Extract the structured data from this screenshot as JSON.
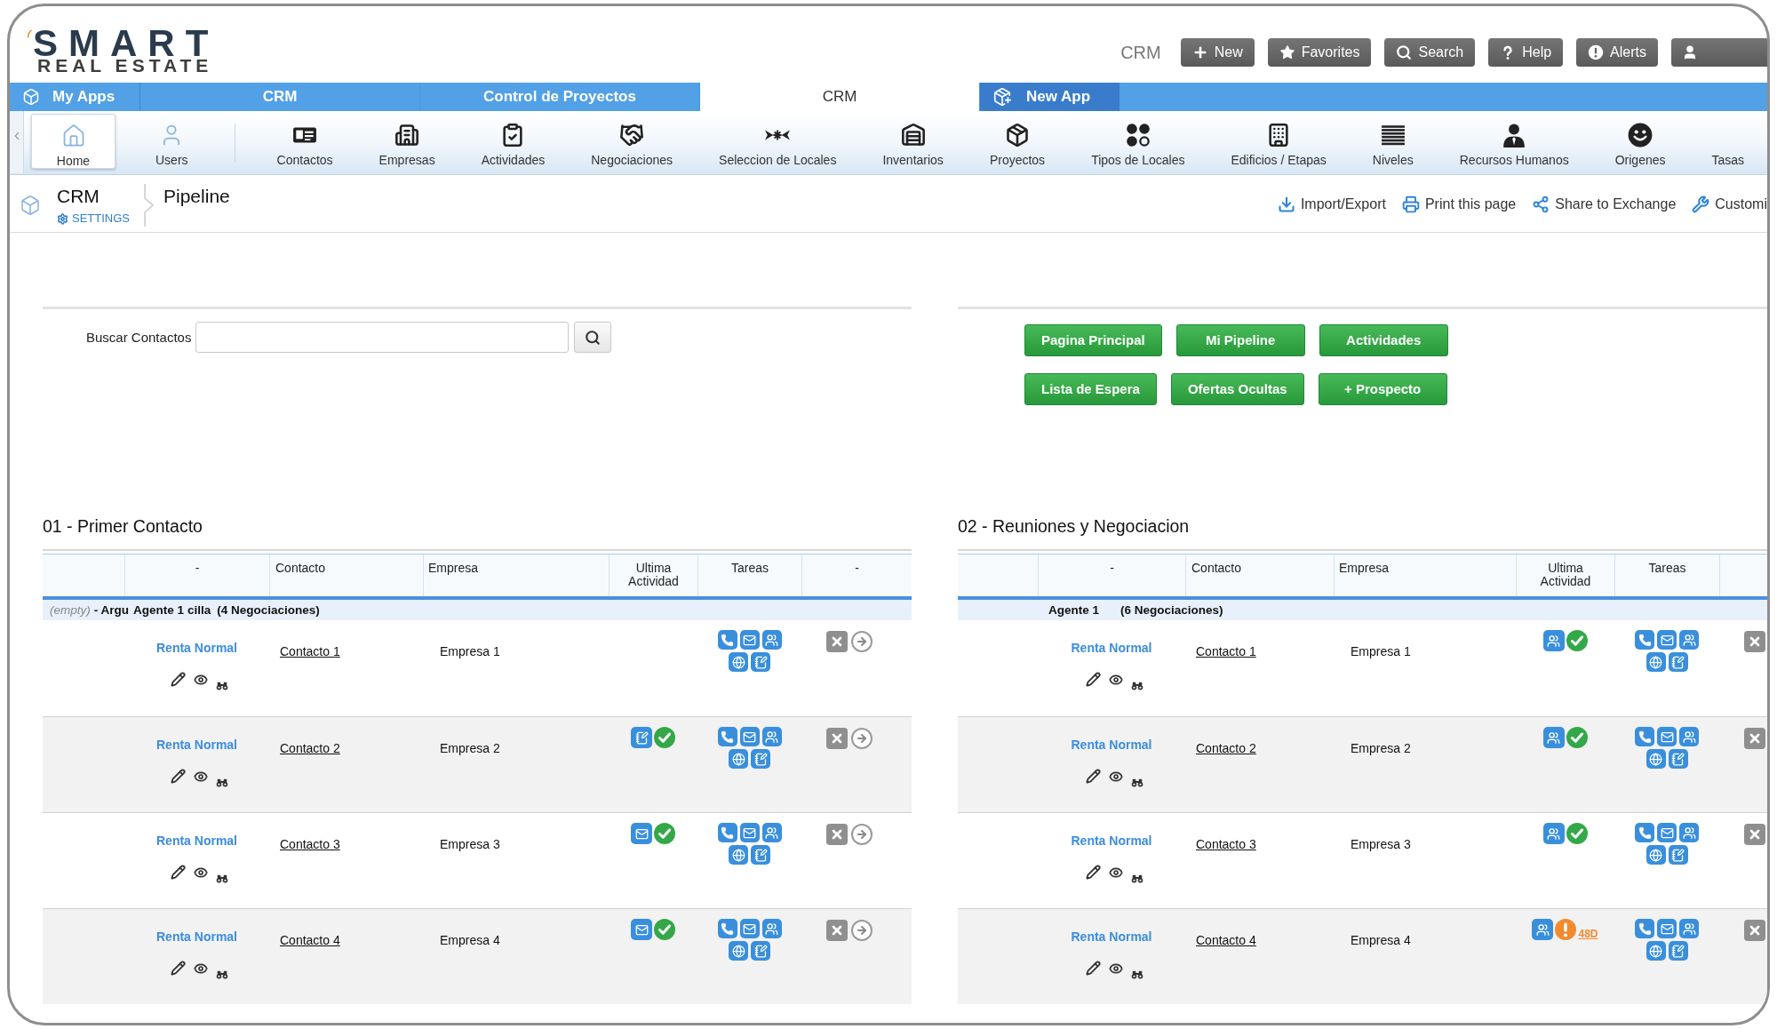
{
  "logo": {
    "wordmark": "SMART",
    "tagline": "REAL ESTATE"
  },
  "header": {
    "app_name": "CRM",
    "buttons": [
      {
        "label": "New"
      },
      {
        "label": "Favorites"
      },
      {
        "label": "Search"
      },
      {
        "label": "Help"
      },
      {
        "label": "Alerts"
      }
    ]
  },
  "app_tabs": [
    {
      "label": "My Apps",
      "kind": "apps",
      "selected": false
    },
    {
      "label": "CRM",
      "kind": "app",
      "selected": false
    },
    {
      "label": "Control de Proyectos",
      "kind": "app",
      "selected": false
    },
    {
      "label": "CRM",
      "kind": "app",
      "selected": true
    },
    {
      "label": "New App",
      "kind": "new",
      "selected": false
    }
  ],
  "nav_items": [
    {
      "label": "Home",
      "selected": true
    },
    {
      "label": "Users",
      "selected": false
    },
    {
      "label": "Contactos",
      "selected": false
    },
    {
      "label": "Empresas",
      "selected": false
    },
    {
      "label": "Actividades",
      "selected": false
    },
    {
      "label": "Negociaciones",
      "selected": false
    },
    {
      "label": "Seleccion de Locales",
      "selected": false
    },
    {
      "label": "Inventarios",
      "selected": false
    },
    {
      "label": "Proyectos",
      "selected": false
    },
    {
      "label": "Tipos de Locales",
      "selected": false
    },
    {
      "label": "Edificios / Etapas",
      "selected": false
    },
    {
      "label": "Niveles",
      "selected": false
    },
    {
      "label": "Recursos Humanos",
      "selected": false
    },
    {
      "label": "Origenes",
      "selected": false
    },
    {
      "label": "Tasas",
      "selected": false
    }
  ],
  "breadcrumb": {
    "app": "CRM",
    "settings": "SETTINGS",
    "page": "Pipeline"
  },
  "page_actions": [
    {
      "label": "Import/Export"
    },
    {
      "label": "Print this page"
    },
    {
      "label": "Share to Exchange"
    },
    {
      "label": "Customi"
    }
  ],
  "search": {
    "label": "Buscar Contactos"
  },
  "quick_links": [
    {
      "label": "Pagina Principal"
    },
    {
      "label": "Mi Pipeline"
    },
    {
      "label": "Actividades"
    },
    {
      "label": "Lista de Espera"
    },
    {
      "label": "Ofertas Ocultas"
    },
    {
      "label": "+ Prospecto"
    }
  ],
  "stages": [
    {
      "title": "01 - Primer Contacto",
      "columns": [
        "-",
        "Contacto",
        "Empresa",
        "Ultima Actividad",
        "Tareas",
        "-"
      ],
      "group": {
        "prefix": "(empty)",
        "owner": "- Argu",
        "agent": "Agente 1",
        "owner_rest": "cilla",
        "count": "(4 Negociaciones)"
      },
      "rows": [
        {
          "deal": "Renta Normal",
          "contact": "Contacto 1",
          "company": "Empresa 1",
          "actions": [
            {
              "kind": "remove"
            },
            {
              "kind": "forward"
            }
          ]
        },
        {
          "deal": "Renta Normal",
          "contact": "Contacto 2",
          "company": "Empresa 2",
          "activity": {
            "kind": "note",
            "overdue": false
          },
          "actions": [
            {
              "kind": "remove"
            },
            {
              "kind": "forward"
            }
          ]
        },
        {
          "deal": "Renta Normal",
          "contact": "Contacto 3",
          "company": "Empresa 3",
          "activity": {
            "kind": "email",
            "overdue": false
          },
          "actions": [
            {
              "kind": "remove"
            },
            {
              "kind": "forward"
            }
          ]
        },
        {
          "deal": "Renta Normal",
          "contact": "Contacto 4",
          "company": "Empresa 4",
          "activity": {
            "kind": "email",
            "overdue": false
          },
          "actions": [
            {
              "kind": "remove"
            },
            {
              "kind": "forward"
            }
          ]
        }
      ]
    },
    {
      "title": "02 - Reuniones y Negociacion",
      "columns": [
        "-",
        "Contacto",
        "Empresa",
        "Ultima Actividad",
        "Tareas"
      ],
      "group": {
        "agent": "Agente 1",
        "count": "(6 Negociaciones)"
      },
      "rows": [
        {
          "deal": "Renta Normal",
          "contact": "Contacto 1",
          "company": "Empresa 1",
          "activity": {
            "kind": "meeting",
            "overdue": false
          },
          "actions": [
            {
              "kind": "remove"
            }
          ]
        },
        {
          "deal": "Renta Normal",
          "contact": "Contacto 2",
          "company": "Empresa 2",
          "activity": {
            "kind": "meeting",
            "overdue": false
          },
          "actions": [
            {
              "kind": "remove"
            }
          ]
        },
        {
          "deal": "Renta Normal",
          "contact": "Contacto 3",
          "company": "Empresa 3",
          "activity": {
            "kind": "meeting",
            "overdue": false
          },
          "actions": [
            {
              "kind": "remove"
            }
          ]
        },
        {
          "deal": "Renta Normal",
          "contact": "Contacto 4",
          "company": "Empresa 4",
          "activity": {
            "kind": "meeting",
            "overdue": true,
            "age": "48D"
          },
          "actions": [
            {
              "kind": "remove"
            }
          ]
        }
      ]
    }
  ]
}
